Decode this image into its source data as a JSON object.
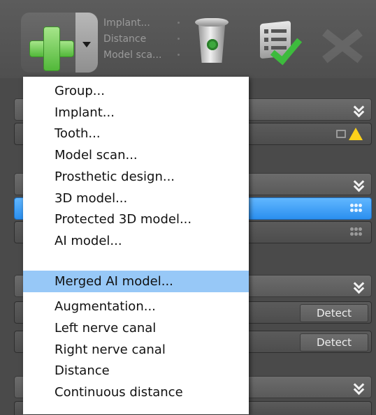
{
  "toolbar": {
    "recent_items": [
      "Implant...",
      "Distance",
      "Model sca..."
    ]
  },
  "panels": {
    "detect_label": "Detect"
  },
  "menu": {
    "items": [
      "Group...",
      "Implant...",
      "Tooth...",
      "Model scan...",
      "Prosthetic design...",
      "3D model...",
      "Protected 3D model...",
      "AI model...",
      "Merged AI model...",
      "Augmentation...",
      "Left nerve canal",
      "Right nerve canal",
      "Distance",
      "Continuous distance"
    ],
    "highlighted_index": 8
  },
  "colors": {
    "highlight": "#97c8f7",
    "selected_row": "#2b8fef",
    "warning": "#ffd21a",
    "add_green": "#52b83a"
  },
  "icons": [
    "add-icon",
    "chevron-down-icon",
    "trash-icon",
    "checklist-icon",
    "close-x-icon",
    "warning-icon",
    "export-icon",
    "dots-icon"
  ]
}
